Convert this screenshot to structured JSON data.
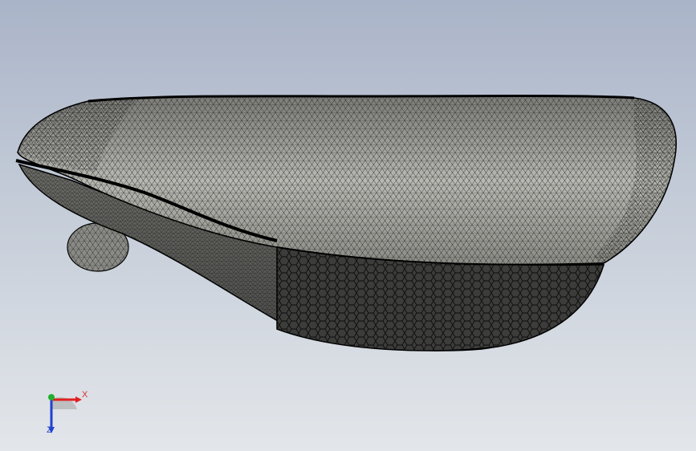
{
  "app": {
    "view": "graphics-area",
    "background_top": "#aab4c8",
    "background_bottom": "#e3e6ea"
  },
  "model": {
    "display_style": "wireframe-mesh",
    "icon": "bicycle-saddle-mesh-icon",
    "mesh_color": "#000000",
    "shell_color": "#8e8e88"
  },
  "triad": {
    "x_label": "X",
    "z_label": "Z",
    "x_color": "#e02020",
    "y_color": "#20b030",
    "z_color": "#2040d0"
  }
}
